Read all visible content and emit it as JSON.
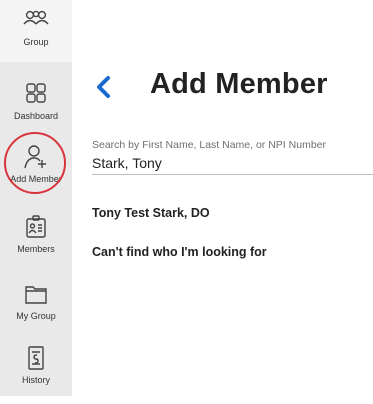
{
  "sidebar": {
    "items": [
      {
        "label": "Group",
        "icon": "group-icon"
      },
      {
        "label": "Dashboard",
        "icon": "dashboard-icon"
      },
      {
        "label": "Add Member",
        "icon": "add-member-icon",
        "active": true
      },
      {
        "label": "Members",
        "icon": "members-icon"
      },
      {
        "label": "My Group",
        "icon": "folder-icon"
      },
      {
        "label": "History",
        "icon": "history-icon"
      }
    ],
    "active_color": "#d9343b"
  },
  "header": {
    "back_icon": "chevron-left-icon",
    "title": "Add Member",
    "accent": "#1a6bd0"
  },
  "search": {
    "label": "Search by First Name, Last Name, or NPI Number",
    "value": "Stark, Tony"
  },
  "results": [
    {
      "label": "Tony Test Stark, DO"
    },
    {
      "label": "Can't find who I'm looking for"
    }
  ]
}
